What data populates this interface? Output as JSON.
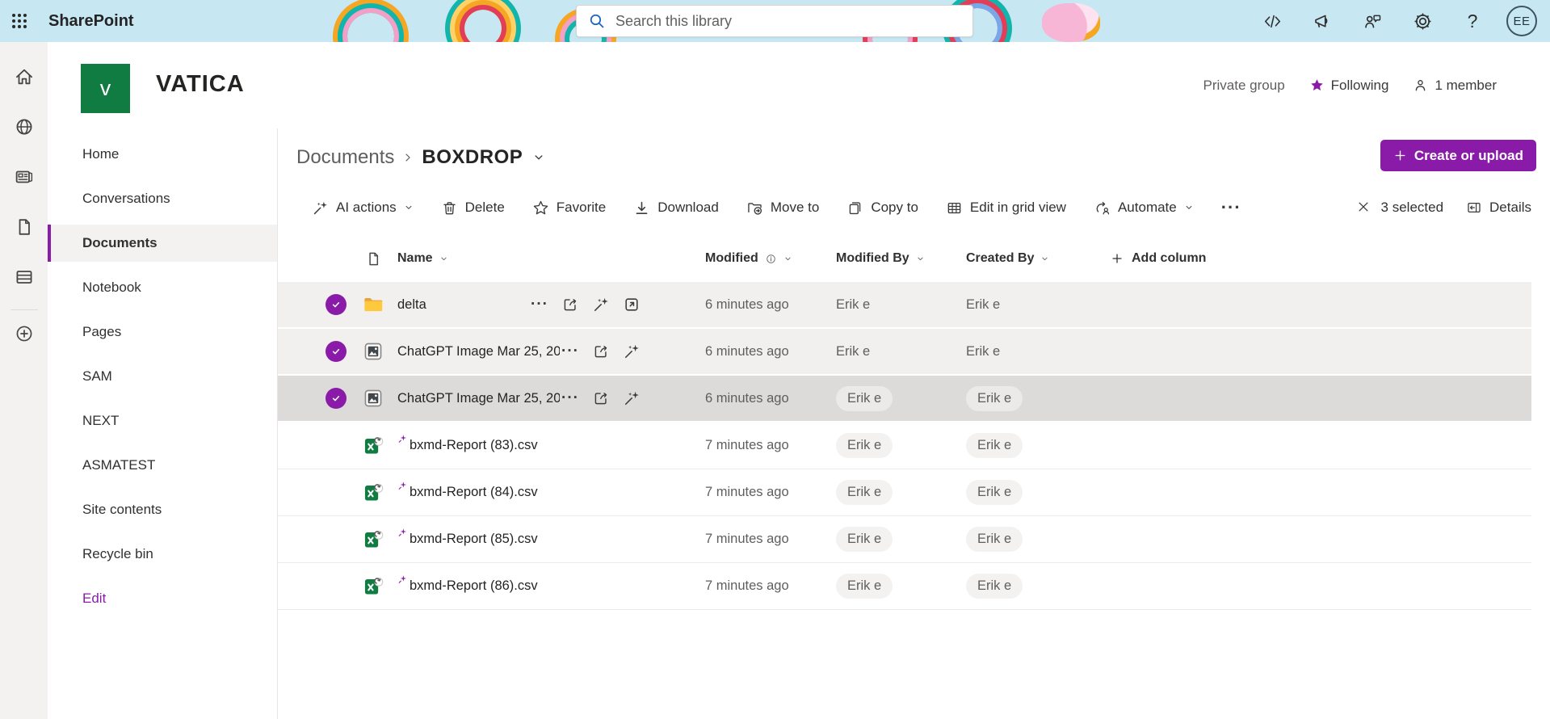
{
  "colors": {
    "accent_purple": "#8A1BA9",
    "logo_green": "#107C41",
    "suite_bar_blue": "#C7E8F3"
  },
  "icons": {
    "more_ellipsis": "···",
    "help": "?"
  },
  "suite_bar": {
    "app_name": "SharePoint",
    "search": {
      "placeholder": "Search this library"
    },
    "avatar_initials": "EE"
  },
  "site_header": {
    "logo_letter": "v",
    "site_name": "VATICA",
    "privacy_label": "Private group",
    "following_label": "Following",
    "member_count_label": "1 member"
  },
  "sidebar": {
    "items": [
      "Home",
      "Conversations",
      "Documents",
      "Notebook",
      "Pages",
      "SAM",
      "NEXT",
      "ASMATEST",
      "Site contents",
      "Recycle bin"
    ],
    "selected": "Documents",
    "edit_label": "Edit"
  },
  "content_header": {
    "breadcrumb": {
      "parent": "Documents",
      "current": "BOXDROP"
    },
    "create_button_label": "Create or upload"
  },
  "toolbar": {
    "items": [
      {
        "label": "AI actions",
        "icon": "ai",
        "dropdown": true
      },
      {
        "label": "Delete",
        "icon": "trash"
      },
      {
        "label": "Favorite",
        "icon": "star"
      },
      {
        "label": "Download",
        "icon": "download"
      },
      {
        "label": "Move to",
        "icon": "move-to"
      },
      {
        "label": "Copy to",
        "icon": "copy-to"
      },
      {
        "label": "Edit in grid view",
        "icon": "grid"
      },
      {
        "label": "Automate",
        "icon": "automate",
        "dropdown": true
      },
      {
        "label": "",
        "icon": "more"
      }
    ],
    "selection_status": "3 selected",
    "details_label": "Details"
  },
  "table": {
    "columns": [
      {
        "label": "Name",
        "sortable": true
      },
      {
        "label": "Modified",
        "sortable": true,
        "info": true
      },
      {
        "label": "Modified By",
        "sortable": true
      },
      {
        "label": "Created By",
        "sortable": true
      }
    ],
    "add_column_label": "Add column",
    "rows": [
      {
        "type": "folder",
        "name": "delta",
        "modified": "6 minutes ago",
        "modified_by": "Erik e",
        "created_by": "Erik e",
        "selected": true,
        "state": "selected",
        "pill": false,
        "new_badge": false,
        "actions": [
          "more",
          "share",
          "ai",
          "open"
        ]
      },
      {
        "type": "image",
        "name": "ChatGPT Image Mar 25, 202...",
        "modified": "6 minutes ago",
        "modified_by": "Erik e",
        "created_by": "Erik e",
        "selected": true,
        "state": "selected",
        "pill": false,
        "new_badge": false,
        "actions": [
          "more",
          "share",
          "ai"
        ]
      },
      {
        "type": "image",
        "name": "ChatGPT Image Mar 25, 202...",
        "modified": "6 minutes ago",
        "modified_by": "Erik e",
        "created_by": "Erik e",
        "selected": true,
        "state": "hovered",
        "pill": true,
        "new_badge": false,
        "actions": [
          "more",
          "share",
          "ai"
        ]
      },
      {
        "type": "csv",
        "name": "bxmd-Report (83).csv",
        "modified": "7 minutes ago",
        "modified_by": "Erik e",
        "created_by": "Erik e",
        "selected": false,
        "state": "none",
        "pill": true,
        "new_badge": true,
        "actions": []
      },
      {
        "type": "csv",
        "name": "bxmd-Report (84).csv",
        "modified": "7 minutes ago",
        "modified_by": "Erik e",
        "created_by": "Erik e",
        "selected": false,
        "state": "none",
        "pill": true,
        "new_badge": true,
        "actions": []
      },
      {
        "type": "csv",
        "name": "bxmd-Report (85).csv",
        "modified": "7 minutes ago",
        "modified_by": "Erik e",
        "created_by": "Erik e",
        "selected": false,
        "state": "none",
        "pill": true,
        "new_badge": true,
        "actions": []
      },
      {
        "type": "csv",
        "name": "bxmd-Report (86).csv",
        "modified": "7 minutes ago",
        "modified_by": "Erik e",
        "created_by": "Erik e",
        "selected": false,
        "state": "none",
        "pill": true,
        "new_badge": true,
        "actions": []
      }
    ]
  }
}
